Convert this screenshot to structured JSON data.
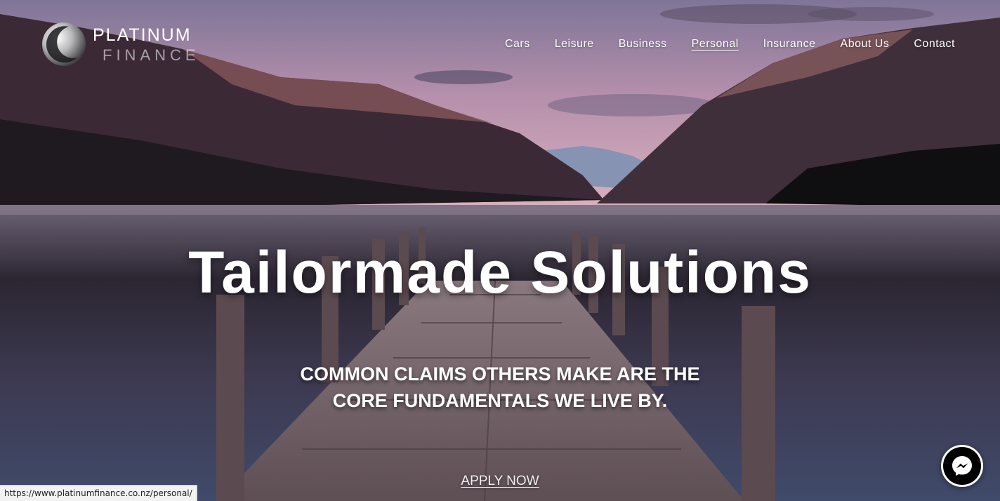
{
  "logo": {
    "line1": "PLATINUM",
    "line2": "FINANCE"
  },
  "nav": [
    {
      "label": "Cars",
      "active": false
    },
    {
      "label": "Leisure",
      "active": false
    },
    {
      "label": "Business",
      "active": false
    },
    {
      "label": "Personal",
      "active": true
    },
    {
      "label": "Insurance",
      "active": false
    },
    {
      "label": "About Us",
      "active": false
    },
    {
      "label": "Contact",
      "active": false
    }
  ],
  "hero": {
    "headline": "Tailormade Solutions",
    "subline_1": "COMMON CLAIMS OTHERS MAKE ARE THE",
    "subline_2": "CORE FUNDAMENTALS WE LIVE BY.",
    "cta": "APPLY NOW"
  },
  "status_bar": {
    "url": "https://www.platinumfinance.co.nz/personal/"
  },
  "icons": {
    "chat": "messenger-icon",
    "logo": "platinum-finance-logo"
  },
  "colors": {
    "text": "#ffffff",
    "sky_top": "#8f7fa3",
    "sky_mid": "#c9a2b4",
    "lake": "#3e4158"
  }
}
